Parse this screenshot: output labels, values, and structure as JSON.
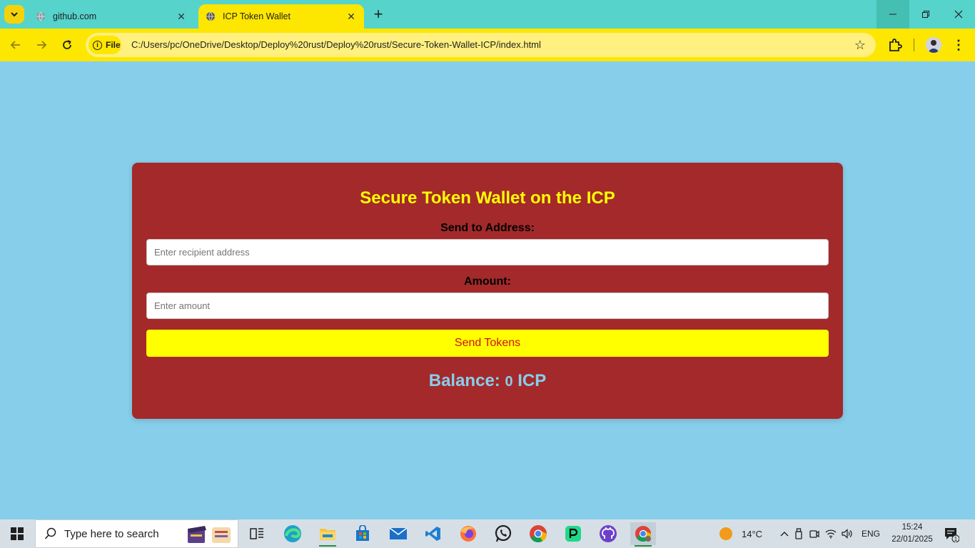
{
  "browser": {
    "tabs": [
      {
        "title": "github.com",
        "active": false
      },
      {
        "title": "ICP Token Wallet",
        "active": true
      }
    ],
    "site_chip_label": "File",
    "url": "C:/Users/pc/OneDrive/Desktop/Deploy%20rust/Deploy%20rust/Secure-Token-Wallet-ICP/index.html"
  },
  "wallet": {
    "title": "Secure Token Wallet on the ICP",
    "address_label": "Send to Address:",
    "address_placeholder": "Enter recipient address",
    "address_value": "",
    "amount_label": "Amount:",
    "amount_placeholder": "Enter amount",
    "amount_value": "",
    "send_button_label": "Send Tokens",
    "balance_label": "Balance:",
    "balance_value": "0",
    "balance_unit": "ICP"
  },
  "taskbar": {
    "search_placeholder": "Type here to search",
    "weather_temp": "14°C",
    "language": "ENG",
    "time": "15:24",
    "date": "22/01/2025",
    "notification_count": "1",
    "apps": [
      "task-view",
      "edge",
      "file-explorer",
      "microsoft-store",
      "mail",
      "vs-code",
      "firefox",
      "whatsapp",
      "chrome",
      "pycharm",
      "github-desktop",
      "chrome-profile"
    ]
  },
  "colors": {
    "page_background": "#87CEEB",
    "card_background": "#A4292A",
    "title_color": "#FFFF00",
    "button_background": "#FFFF00",
    "button_text": "#D01010",
    "browser_theme": "#FDE600",
    "tab_strip": "#56D3CB"
  }
}
